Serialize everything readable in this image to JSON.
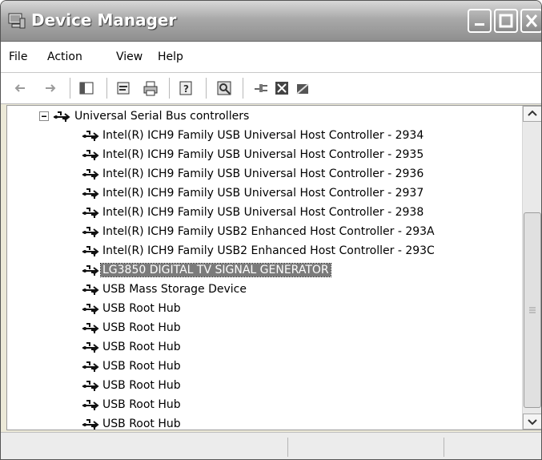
{
  "window": {
    "title": "Device Manager",
    "title_icon": "computer-icon",
    "min_icon": "minimize-icon",
    "max_icon": "maximize-icon",
    "close_icon": "close-icon"
  },
  "menu": {
    "items": [
      "File",
      "Action",
      "View",
      "Help"
    ]
  },
  "toolbar": {
    "icons": [
      "back-icon",
      "forward-icon",
      "show-hide-console-tree-icon",
      "properties-icon",
      "print-icon",
      "help-icon",
      "scan-hardware-icon",
      "update-driver-icon",
      "uninstall-icon",
      "disable-icon"
    ]
  },
  "tree": {
    "root_label": "Universal Serial Bus controllers",
    "items": [
      {
        "label": "Intel(R) ICH9 Family USB Universal Host Controller - 2934"
      },
      {
        "label": "Intel(R) ICH9 Family USB Universal Host Controller - 2935"
      },
      {
        "label": "Intel(R) ICH9 Family USB Universal Host Controller - 2936"
      },
      {
        "label": "Intel(R) ICH9 Family USB Universal Host Controller - 2937"
      },
      {
        "label": "Intel(R) ICH9 Family USB Universal Host Controller - 2938"
      },
      {
        "label": "Intel(R) ICH9 Family USB2 Enhanced Host Controller - 293A"
      },
      {
        "label": "Intel(R) ICH9 Family USB2 Enhanced Host Controller - 293C"
      },
      {
        "label": "LG3850 DIGITAL TV SIGNAL GENERATOR",
        "selected": true
      },
      {
        "label": "USB Mass Storage Device"
      },
      {
        "label": "USB Root Hub"
      },
      {
        "label": "USB Root Hub"
      },
      {
        "label": "USB Root Hub"
      },
      {
        "label": "USB Root Hub"
      },
      {
        "label": "USB Root Hub"
      },
      {
        "label": "USB Root Hub"
      },
      {
        "label": "USB Root Hub"
      }
    ],
    "item_icon": "usb-icon",
    "expand_icon": "minus-expander-icon"
  },
  "status": {
    "panes": [
      "",
      "",
      ""
    ]
  },
  "colors": {
    "selected_bg": "#7b7b7b",
    "window_frame": "#8f8f8f"
  }
}
